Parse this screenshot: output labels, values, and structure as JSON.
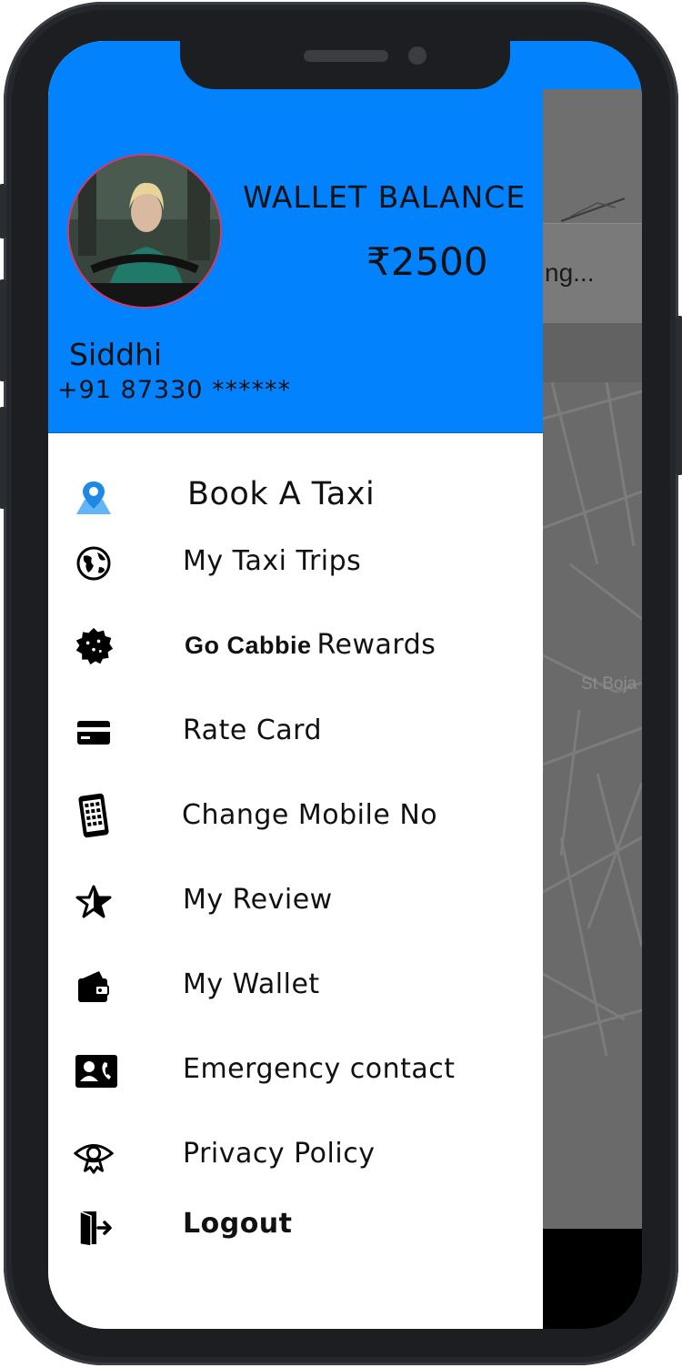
{
  "drawer": {
    "wallet_label": "WALLET BALANCE",
    "wallet_amount": "₹2500",
    "user_name": "Siddhi",
    "user_phone": "+91 87330 ******"
  },
  "menu": {
    "items": [
      {
        "label": "Book A Taxi",
        "icon": "map-pin-icon"
      },
      {
        "label": "My Taxi Trips",
        "icon": "globe-icon"
      },
      {
        "brand": "Go Cabbie",
        "label": "Rewards",
        "icon": "badge-icon"
      },
      {
        "label": "Rate Card",
        "icon": "credit-card-icon"
      },
      {
        "label": "Change Mobile No",
        "icon": "phone-icon"
      },
      {
        "label": "My Review",
        "icon": "star-icon"
      },
      {
        "label": "My Wallet",
        "icon": "wallet-icon"
      },
      {
        "label": "Emergency contact",
        "icon": "contact-card-icon"
      },
      {
        "label": "Privacy Policy",
        "icon": "eye-icon"
      },
      {
        "label": "Logout",
        "icon": "logout-icon"
      }
    ]
  },
  "map": {
    "loading_text": "ng...",
    "street_label": "St Boja"
  },
  "colors": {
    "header_blue": "#0382fe",
    "map_gray": "#6a6a6a",
    "icon_blue": "#1e88e5"
  }
}
